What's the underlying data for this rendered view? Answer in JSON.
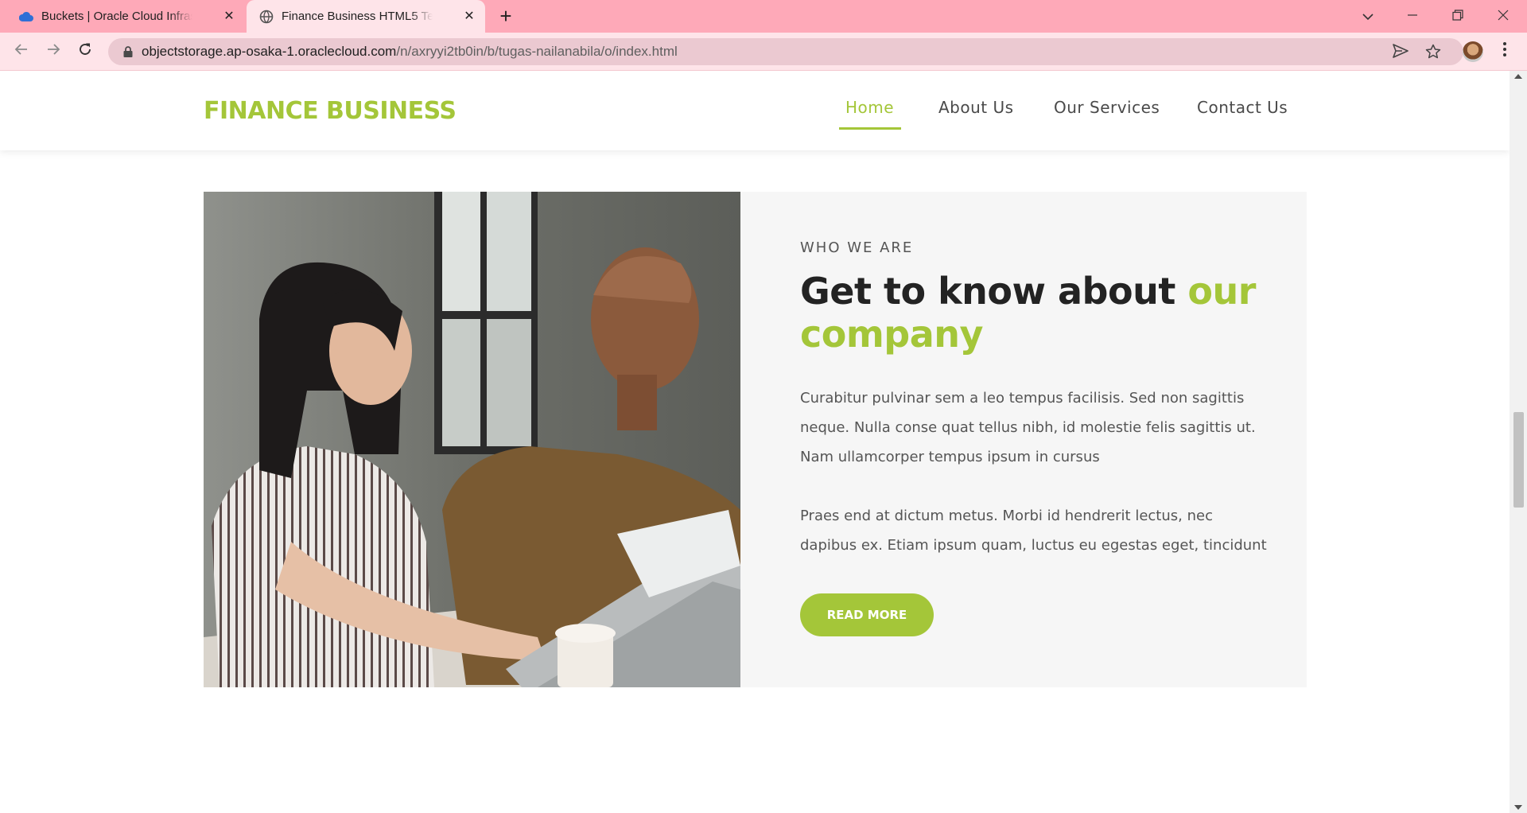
{
  "browser": {
    "tabs": [
      {
        "title": "Buckets | Oracle Cloud Infrastructure",
        "active": false,
        "favicon": "cloud-icon"
      },
      {
        "title": "Finance Business HTML5 Template",
        "active": true,
        "favicon": "globe-icon"
      }
    ],
    "url_host": "objectstorage.ap-osaka-1.oraclecloud.com",
    "url_path": "/n/axryyi2tb0in/b/tugas-nailanabila/o/index.html",
    "colors": {
      "tabbar": "#fea9b8",
      "toolbar": "#fee4e9",
      "omnibox": "#ebc9d1"
    }
  },
  "site": {
    "logo": "FINANCE BUSINESS",
    "nav": [
      {
        "label": "Home",
        "active": true
      },
      {
        "label": "About Us",
        "active": false
      },
      {
        "label": "Our Services",
        "active": false
      },
      {
        "label": "Contact Us",
        "active": false
      }
    ],
    "accent_color": "#a4c639"
  },
  "about": {
    "eyebrow": "WHO WE ARE",
    "headline_plain": "Get to know about",
    "headline_accent_1": "our",
    "headline_accent_2": "company",
    "paragraph_1": "Curabitur pulvinar sem a leo tempus facilisis. Sed non sagittis neque. Nulla conse quat tellus nibh, id molestie felis sagittis ut. Nam ullamcorper tempus ipsum in cursus",
    "paragraph_2": "Praes end at dictum metus. Morbi id hendrerit lectus, nec dapibus ex. Etiam ipsum quam, luctus eu egestas eget, tincidunt",
    "button": "READ MORE"
  }
}
